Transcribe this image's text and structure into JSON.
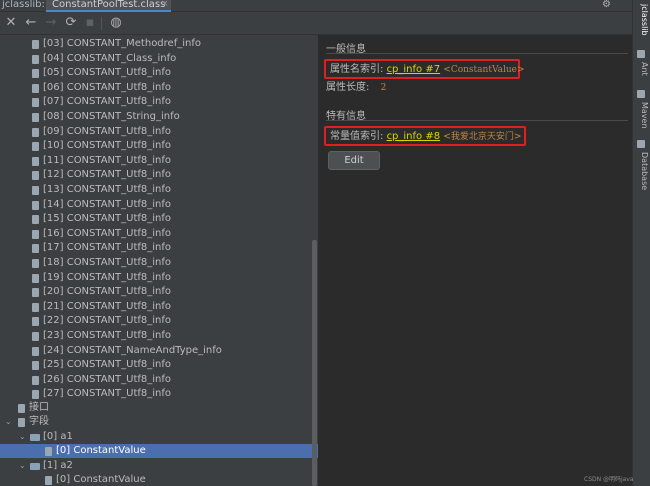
{
  "tabbar": {
    "prefix": "jclasslib:",
    "active_tab": "ConstantPoolTest.class",
    "close": "×",
    "gear": "⚙",
    "minimize": "—"
  },
  "toolbar": {
    "close": "✕",
    "back": "←",
    "forward": "→",
    "refresh": "⟳",
    "save": "▪",
    "browser": "◍"
  },
  "tree": {
    "rows": [
      {
        "label": "[03] CONSTANT_Methodref_info"
      },
      {
        "label": "[04] CONSTANT_Class_info"
      },
      {
        "label": "[05] CONSTANT_Utf8_info"
      },
      {
        "label": "[06] CONSTANT_Utf8_info"
      },
      {
        "label": "[07] CONSTANT_Utf8_info"
      },
      {
        "label": "[08] CONSTANT_String_info"
      },
      {
        "label": "[09] CONSTANT_Utf8_info"
      },
      {
        "label": "[10] CONSTANT_Utf8_info"
      },
      {
        "label": "[11] CONSTANT_Utf8_info"
      },
      {
        "label": "[12] CONSTANT_Utf8_info"
      },
      {
        "label": "[13] CONSTANT_Utf8_info"
      },
      {
        "label": "[14] CONSTANT_Utf8_info"
      },
      {
        "label": "[15] CONSTANT_Utf8_info"
      },
      {
        "label": "[16] CONSTANT_Utf8_info"
      },
      {
        "label": "[17] CONSTANT_Utf8_info"
      },
      {
        "label": "[18] CONSTANT_Utf8_info"
      },
      {
        "label": "[19] CONSTANT_Utf8_info"
      },
      {
        "label": "[20] CONSTANT_Utf8_info"
      },
      {
        "label": "[21] CONSTANT_Utf8_info"
      },
      {
        "label": "[22] CONSTANT_Utf8_info"
      },
      {
        "label": "[23] CONSTANT_Utf8_info"
      },
      {
        "label": "[24] CONSTANT_NameAndType_info"
      },
      {
        "label": "[25] CONSTANT_Utf8_info"
      },
      {
        "label": "[26] CONSTANT_Utf8_info"
      },
      {
        "label": "[27] CONSTANT_Utf8_info"
      }
    ],
    "interfaces": "接口",
    "fields": "字段",
    "field_a1": "[0] a1",
    "field_a1_attr": "[0] ConstantValue",
    "field_a2": "[1] a2",
    "field_a2_attr": "[0] ConstantValue",
    "arrow_open": "⌄",
    "arrow_closed": "›"
  },
  "detail": {
    "general_title": "一般信息",
    "name_index_label": "属性名索引:",
    "name_index_link": "cp_info #7",
    "name_index_comment": "<ConstantValue>",
    "length_label": "属性长度:",
    "length_value": "2",
    "specific_title": "特有信息",
    "const_index_label": "常量值索引:",
    "const_index_link": "cp_info #8",
    "const_index_comment": "<我爱北京天安门>",
    "edit_button": "Edit"
  },
  "stripe": {
    "items": [
      "jclasslib",
      "Ant",
      "Maven",
      "Database"
    ]
  },
  "watermark": "CSDN @明码java"
}
